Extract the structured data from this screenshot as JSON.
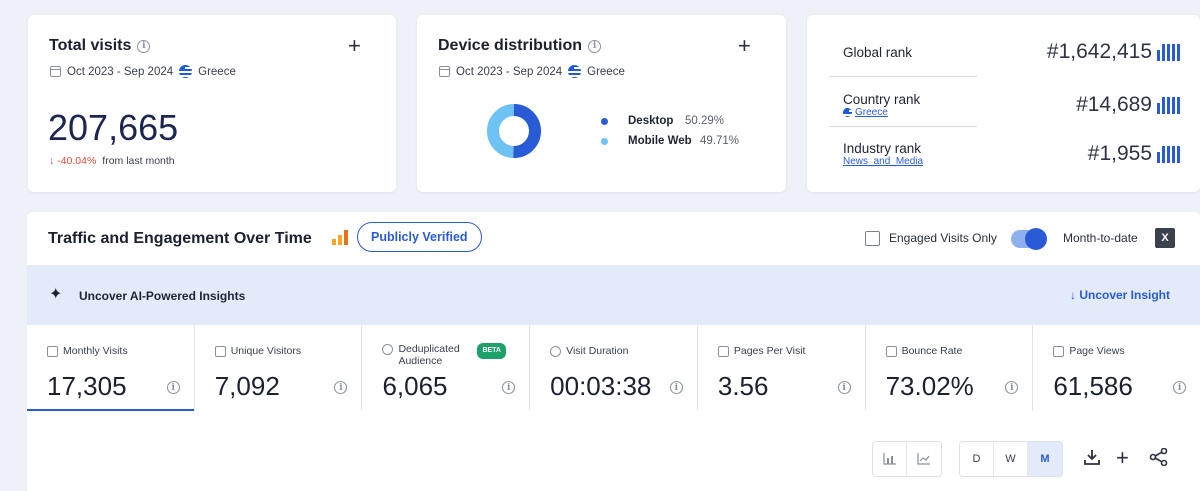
{
  "total_visits": {
    "title": "Total visits",
    "date_range": "Oct 2023 - Sep 2024",
    "country": "Greece",
    "value": "207,665",
    "change": "↓ -40.04%",
    "change_suffix": "from last month",
    "change_color": "#e04a3a"
  },
  "device_distribution": {
    "title": "Device distribution",
    "date_range": "Oct 2023 - Sep 2024",
    "country": "Greece",
    "items": [
      {
        "label": "Desktop",
        "value": "50.29%",
        "fraction": 0.5029,
        "color": "#2a5bd7"
      },
      {
        "label": "Mobile Web",
        "value": "49.71%",
        "fraction": 0.4971,
        "color": "#6ec3f4"
      }
    ]
  },
  "ranks": {
    "global": {
      "label": "Global rank",
      "value": "#1,642,415"
    },
    "country": {
      "label": "Country rank",
      "link": "Greece",
      "value": "#14,689"
    },
    "industry": {
      "label": "Industry rank",
      "link": "News_and_Media",
      "value": "#1,955"
    }
  },
  "traffic": {
    "title": "Traffic and Engagement Over Time",
    "verified_label": "Publicly Verified",
    "engaged_label": "Engaged Visits Only",
    "month_to_date_label": "Month-to-date",
    "excel_icon": "X"
  },
  "insights": {
    "label": "Uncover AI-Powered Insights",
    "link": "↓ Uncover Insight"
  },
  "metrics": [
    {
      "label": "Monthly Visits",
      "value": "17,305"
    },
    {
      "label": "Unique Visitors",
      "value": "7,092"
    },
    {
      "label": "Deduplicated Audience",
      "value": "6,065",
      "badge": "BETA"
    },
    {
      "label": "Visit Duration",
      "value": "00:03:38"
    },
    {
      "label": "Pages Per Visit",
      "value": "3.56"
    },
    {
      "label": "Bounce Rate",
      "value": "73.02%"
    },
    {
      "label": "Page Views",
      "value": "61,586"
    }
  ],
  "toolbar": {
    "granularity": [
      "D",
      "W",
      "M"
    ],
    "selected": "M"
  },
  "colors": {
    "accent": "#2a5bd7",
    "beta_badge": "#1fa16b"
  }
}
